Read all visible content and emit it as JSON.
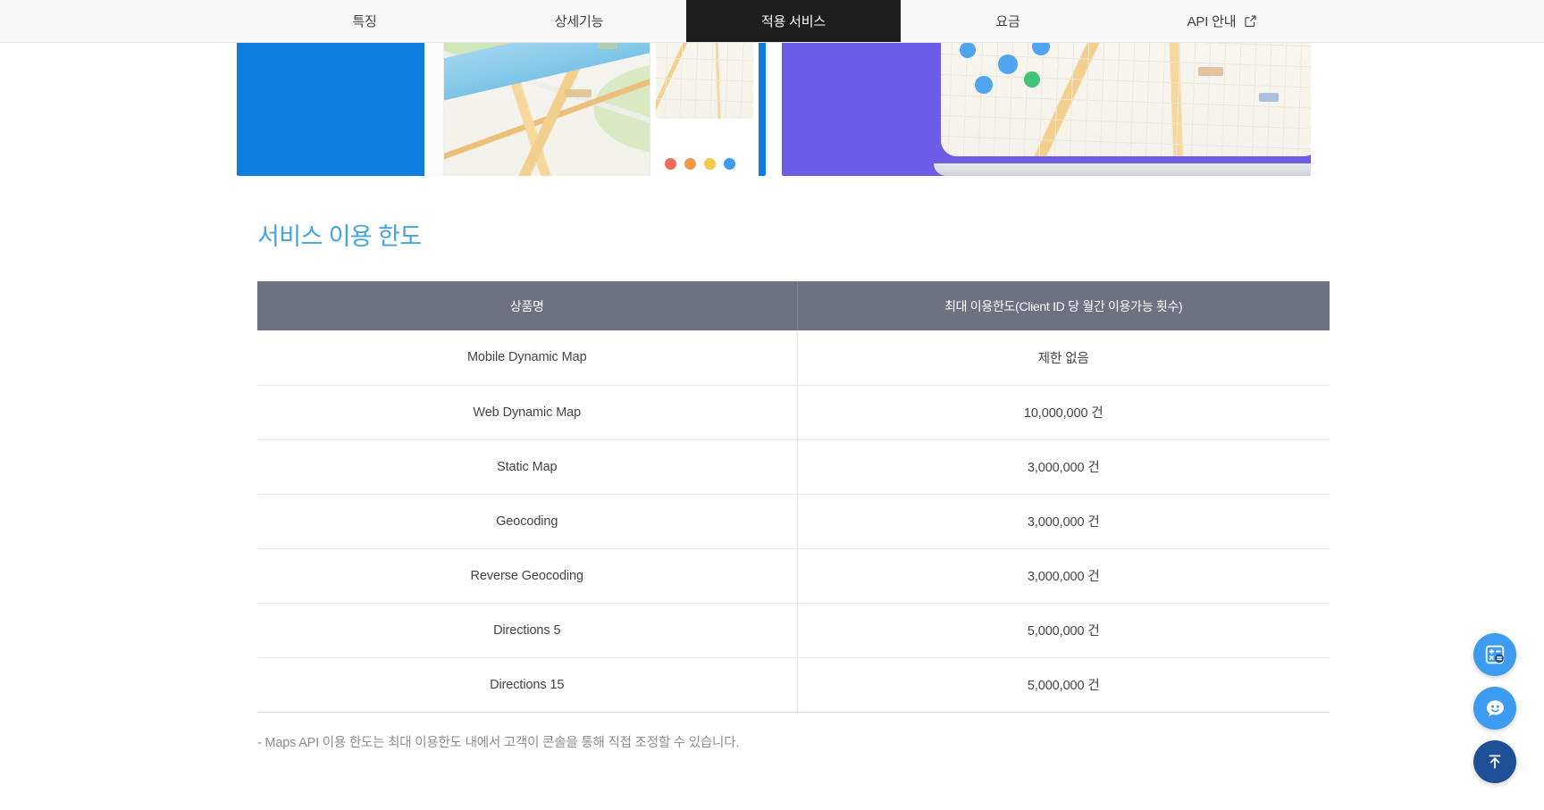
{
  "nav": {
    "tabs": [
      {
        "label": "특징",
        "active": false,
        "icon": null
      },
      {
        "label": "상세기능",
        "active": false,
        "icon": null
      },
      {
        "label": "적용 서비스",
        "active": true,
        "icon": null
      },
      {
        "label": "요금",
        "active": false,
        "icon": null
      },
      {
        "label": "API 안내",
        "active": false,
        "icon": "external-link-icon"
      }
    ]
  },
  "banner": {
    "cards": [
      {
        "name": "mobile-dynamic-map-card",
        "accent_color": "#0d7ee0"
      },
      {
        "name": "web-dynamic-map-card",
        "accent_color": "#6c5ce7"
      }
    ]
  },
  "section": {
    "title": "서비스 이용 한도",
    "title_color": "#41a5e0"
  },
  "table": {
    "header_bg": "#6e717f",
    "columns": [
      "상품명",
      "최대 이용한도(Client ID 당 월간 이용가능 횟수)"
    ],
    "rows": [
      {
        "product": "Mobile Dynamic Map",
        "limit": "제한 없음"
      },
      {
        "product": "Web Dynamic Map",
        "limit": "10,000,000 건"
      },
      {
        "product": "Static Map",
        "limit": "3,000,000 건"
      },
      {
        "product": "Geocoding",
        "limit": "3,000,000 건"
      },
      {
        "product": "Reverse Geocoding",
        "limit": "3,000,000 건"
      },
      {
        "product": "Directions 5",
        "limit": "5,000,000 건"
      },
      {
        "product": "Directions 15",
        "limit": "5,000,000 건"
      }
    ]
  },
  "footnote": "- Maps API 이용 한도는 최대 이용한도 내에서 고객이 콘솔을 통해 직접 조정할 수 있습니다.",
  "fabs": [
    {
      "name": "calculator-fab",
      "icon": "calculator-icon",
      "color": "#3d9bf0"
    },
    {
      "name": "chat-support-fab",
      "icon": "chat-smiley-icon",
      "color": "#3d9bf0"
    },
    {
      "name": "scroll-to-top-fab",
      "icon": "arrow-up-icon",
      "color": "#1f4f96"
    }
  ]
}
